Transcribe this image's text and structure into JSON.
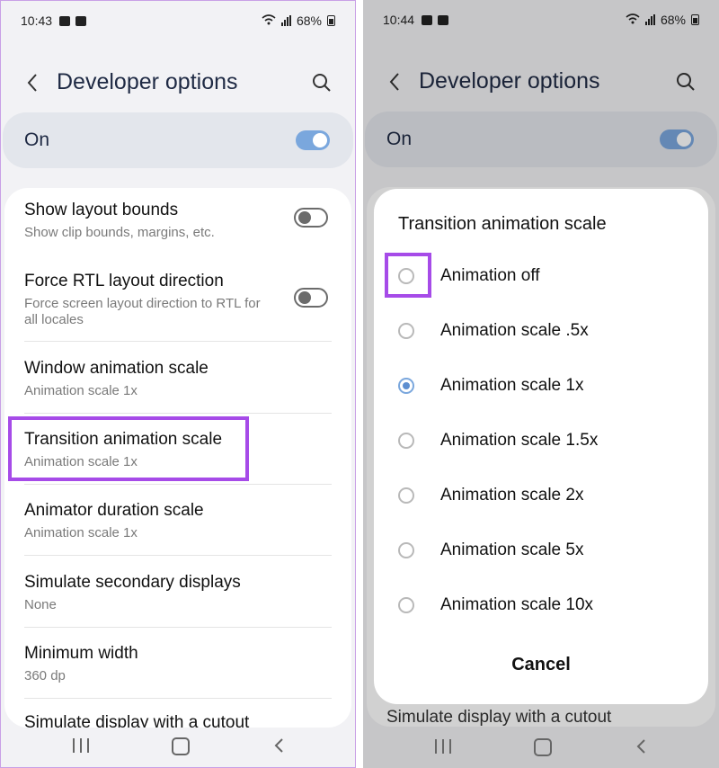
{
  "left": {
    "status": {
      "time": "10:43",
      "battery": "68%"
    },
    "title": "Developer options",
    "master": {
      "label": "On",
      "state": "on"
    },
    "settings": [
      {
        "title": "Show layout bounds",
        "subtitle": "Show clip bounds, margins, etc.",
        "toggle": "off"
      },
      {
        "title": "Force RTL layout direction",
        "subtitle": "Force screen layout direction to RTL for all locales",
        "toggle": "off"
      },
      {
        "title": "Window animation scale",
        "subtitle": "Animation scale 1x"
      },
      {
        "title": "Transition animation scale",
        "subtitle": "Animation scale 1x"
      },
      {
        "title": "Animator duration scale",
        "subtitle": "Animation scale 1x"
      },
      {
        "title": "Simulate secondary displays",
        "subtitle": "None"
      },
      {
        "title": "Minimum width",
        "subtitle": "360 dp"
      },
      {
        "title": "Simulate display with a cutout",
        "subtitle": ""
      }
    ]
  },
  "right": {
    "status": {
      "time": "10:44",
      "battery": "68%"
    },
    "title": "Developer options",
    "master": {
      "label": "On",
      "state": "on"
    },
    "dialog": {
      "title": "Transition animation scale",
      "options": [
        "Animation off",
        "Animation scale .5x",
        "Animation scale 1x",
        "Animation scale 1.5x",
        "Animation scale 2x",
        "Animation scale 5x",
        "Animation scale 10x"
      ],
      "selected": "Animation scale 1x",
      "cancel": "Cancel"
    },
    "peek_text": "Simulate display with a cutout"
  },
  "colors": {
    "highlight": "#a64be8",
    "accent": "#7aa7dd",
    "title": "#1f2a44"
  }
}
